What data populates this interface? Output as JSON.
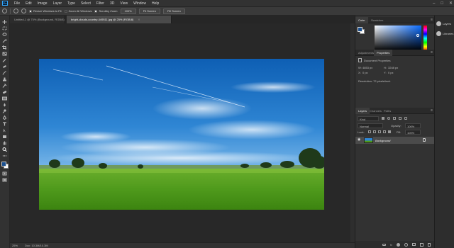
{
  "app": {
    "logo": "Ps"
  },
  "menu": [
    "File",
    "Edit",
    "Image",
    "Layer",
    "Type",
    "Select",
    "Filter",
    "3D",
    "View",
    "Window",
    "Help"
  ],
  "window_controls": [
    "–",
    "□",
    "✕"
  ],
  "options_bar": {
    "resize_windows_label": "Resize Windows to Fit",
    "zoom_all_windows_label": "Zoom All Windows",
    "scrubby_zoom_label": "Scrubby Zoom",
    "zoom_100_label": "100%",
    "fit_screen_label": "Fit Screen",
    "fill_screen_label": "Fill Screen"
  },
  "tabs": [
    {
      "label": "Untitled-1 @ 75% (Background, RGB/8)"
    },
    {
      "label": "bright-clouds-country-449511.jpg @ 25% (RGB/8)",
      "active": true
    }
  ],
  "status_bar": {
    "zoom": "25%",
    "doc": "Doc: 10.3M/10.3M"
  },
  "color_panel": {
    "tabs": [
      "Color",
      "Swatches"
    ]
  },
  "properties_panel": {
    "tabs": [
      "Adjustments",
      "Properties"
    ],
    "title": "Document Properties",
    "w_label": "W:",
    "w_value": "4853 px",
    "h_label": "H:",
    "h_value": "3248 px",
    "x_label": "X:",
    "x_value": "0 px",
    "y_label": "Y:",
    "y_value": "0 px",
    "resolution": "Resolution: 72 pixels/inch"
  },
  "layers_panel": {
    "tabs": [
      "Layers",
      "Channels",
      "Paths"
    ],
    "kind_label": "Kind",
    "blend_mode": "Normal",
    "opacity_label": "Opacity:",
    "opacity_value": "100%",
    "lock_label": "Lock:",
    "fill_label": "Fill:",
    "fill_value": "100%",
    "layers": [
      {
        "name": "Background"
      }
    ],
    "footer_icons": [
      "link-icon",
      "fx-icon",
      "mask-icon",
      "adjustment-icon",
      "group-icon",
      "new-layer-icon",
      "trash-icon"
    ]
  },
  "strip": {
    "items": [
      "Layers",
      "Libraries"
    ]
  },
  "colors": {
    "accent": "#31a8ff",
    "panel": "#323232",
    "canvas": "#282828",
    "foreground": "#1a4f8f",
    "background": "#ffffff"
  }
}
